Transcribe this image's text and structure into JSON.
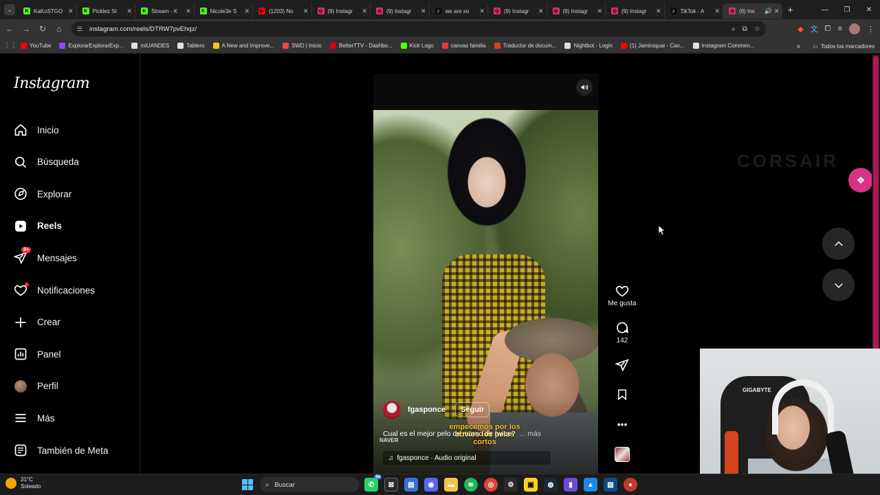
{
  "browser": {
    "tabs": [
      {
        "title": "KaKoSTGO",
        "fav_color": "#53fc18",
        "fav_glyph": "K"
      },
      {
        "title": "Picklez St",
        "fav_color": "#53fc18",
        "fav_glyph": "K"
      },
      {
        "title": "Stream - K",
        "fav_color": "#53fc18",
        "fav_glyph": "K"
      },
      {
        "title": "Nicole3e S",
        "fav_color": "#53fc18",
        "fav_glyph": "K"
      },
      {
        "title": "(1203) No",
        "fav_color": "#ff0000",
        "fav_glyph": "▶"
      },
      {
        "title": "(9) Instagr",
        "fav_color": "#e1306c",
        "fav_glyph": "◎"
      },
      {
        "title": "(9) Instagr",
        "fav_color": "#e1306c",
        "fav_glyph": "◎"
      },
      {
        "title": "we are so",
        "fav_color": "#111111",
        "fav_glyph": "♪"
      },
      {
        "title": "(9) Instagr",
        "fav_color": "#e1306c",
        "fav_glyph": "◎"
      },
      {
        "title": "(9) Instagr",
        "fav_color": "#e1306c",
        "fav_glyph": "◎"
      },
      {
        "title": "(9) Instagr",
        "fav_color": "#e1306c",
        "fav_glyph": "◎"
      },
      {
        "title": "TikTok - A",
        "fav_color": "#111111",
        "fav_glyph": "♪"
      },
      {
        "title": "(9) Ins",
        "fav_color": "#e1306c",
        "fav_glyph": "◎",
        "active": true
      }
    ],
    "url": "instagram.com/reels/DTRW7pvEhqz/",
    "bookmarks": [
      {
        "label": "YouTube",
        "color": "#ff0000"
      },
      {
        "label": "ExplorarExplorarExp...",
        "color": "#9146ff"
      },
      {
        "label": "miUANDES",
        "color": "#e0e0e0"
      },
      {
        "label": "Tablero",
        "color": "#e0e0e0"
      },
      {
        "label": "A New and Improve...",
        "color": "#f5c518"
      },
      {
        "label": "SWD | Inicio",
        "color": "#e74c3c"
      },
      {
        "label": "BetterTTV - Dashbo...",
        "color": "#d50000"
      },
      {
        "label": "Kick Logo",
        "color": "#53fc18"
      },
      {
        "label": "canvas familia",
        "color": "#e53935"
      },
      {
        "label": "Traductor de docum...",
        "color": "#e53935"
      },
      {
        "label": "Nightbot - Login",
        "color": "#e0e0e0"
      },
      {
        "label": "(1) Jamiroquai - Can...",
        "color": "#ff0000"
      },
      {
        "label": "Instagram Commen...",
        "color": "#e0e0e0"
      }
    ],
    "all_bookmarks": "Todos los marcadores"
  },
  "instagram": {
    "logo": "Instagram",
    "nav": [
      {
        "label": "Inicio",
        "icon": "home-icon"
      },
      {
        "label": "Búsqueda",
        "icon": "search-icon"
      },
      {
        "label": "Explorar",
        "icon": "compass-icon"
      },
      {
        "label": "Reels",
        "icon": "reels-icon",
        "bold": true
      },
      {
        "label": "Mensajes",
        "icon": "messenger-icon",
        "badge": "9+"
      },
      {
        "label": "Notificaciones",
        "icon": "heart-icon",
        "dot": true
      },
      {
        "label": "Crear",
        "icon": "plus-icon"
      },
      {
        "label": "Panel",
        "icon": "dashboard-icon"
      },
      {
        "label": "Perfil",
        "icon": "avatar"
      },
      {
        "label": "Más",
        "icon": "menu-icon"
      },
      {
        "label": "También de Meta",
        "icon": "threads-icon"
      }
    ],
    "reel": {
      "username": "fgasponce",
      "follow": "Seguir",
      "caption_overlay": "empecemos por los obvios los pelos cortos",
      "caption": "Cual es el mejor pelo de momo de twice?",
      "more": "... más",
      "watermark": "NAVER",
      "audio": "fgasponce · Audio original",
      "likes_label": "Me gusta",
      "comments": "142"
    },
    "ad_brand": "CORSAIR"
  },
  "webcam": {
    "chair_brand": "GIGABYTE"
  },
  "taskbar": {
    "weather_temp": "31°C",
    "weather_desc": "Soleado",
    "search": "Buscar",
    "badge": "56"
  }
}
